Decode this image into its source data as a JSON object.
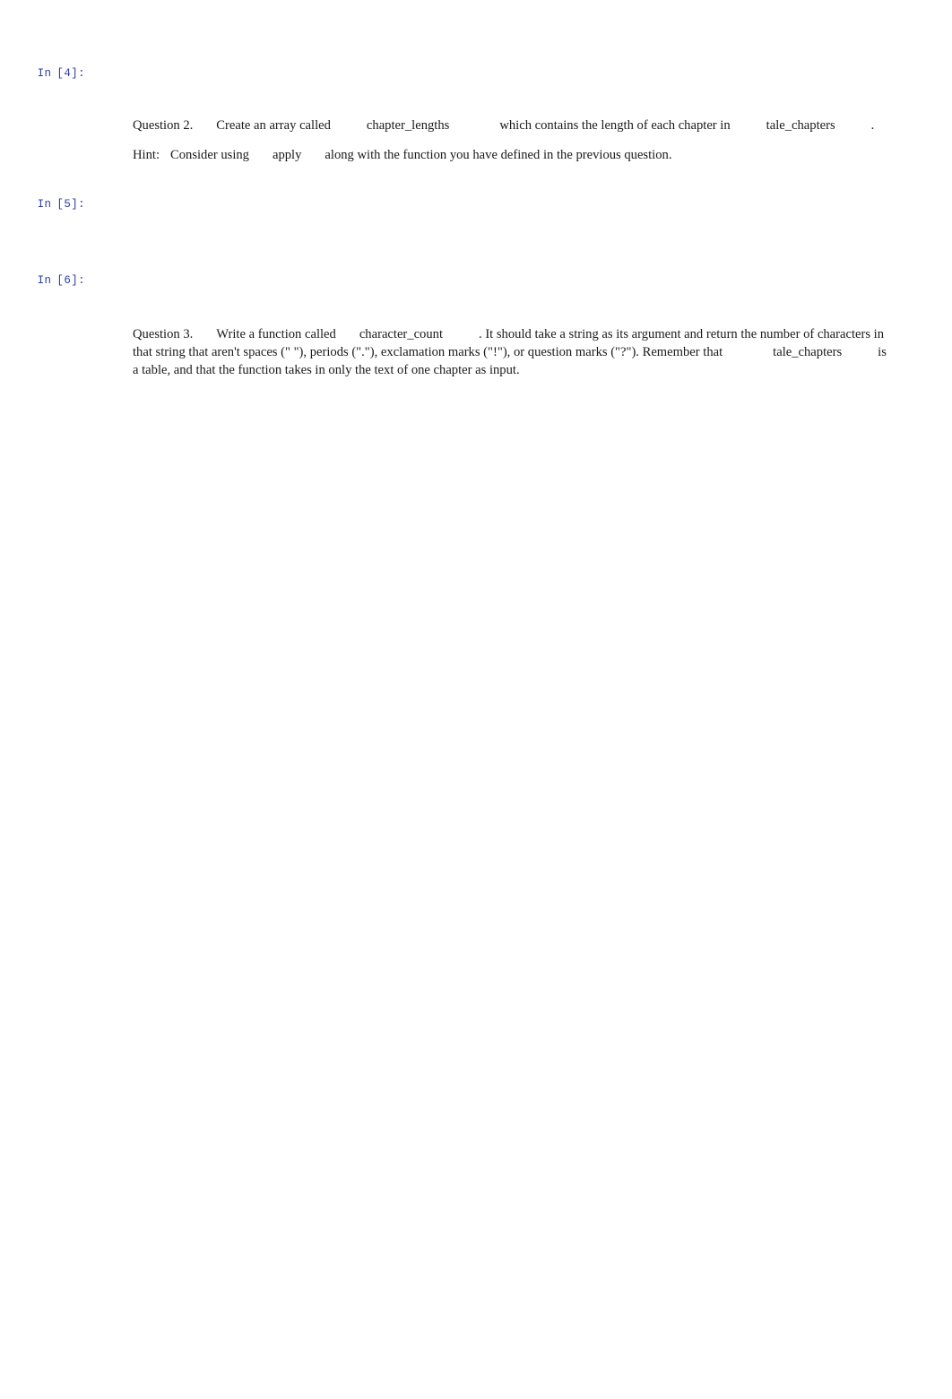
{
  "document": {
    "type": "jupyter-notebook-export",
    "background_color": "#ffffff",
    "text_color": "#1a1a1a",
    "prompt_color": "#303f9f"
  },
  "cells": [
    {
      "kind": "code",
      "prompt_in": "In",
      "prompt_num": "[4]:",
      "source": ""
    },
    {
      "kind": "markdown",
      "paragraphs": [
        {
          "label": "Question 2.",
          "segments": [
            {
              "type": "text",
              "value": "Create an array called"
            },
            {
              "type": "code",
              "value": "chapter_lengths"
            },
            {
              "type": "text",
              "value": "which contains the length of each chapter in"
            },
            {
              "type": "code",
              "value": "tale_chapters"
            },
            {
              "type": "text",
              "value": "."
            }
          ]
        },
        {
          "label": "Hint:",
          "segments": [
            {
              "type": "text",
              "value": "Consider using"
            },
            {
              "type": "code",
              "value": "apply"
            },
            {
              "type": "text",
              "value": "along with the function you have defined in the previous question."
            }
          ]
        }
      ]
    },
    {
      "kind": "code",
      "prompt_in": "In",
      "prompt_num": "[5]:",
      "source": ""
    },
    {
      "kind": "code",
      "prompt_in": "In",
      "prompt_num": "[6]:",
      "source": ""
    },
    {
      "kind": "markdown",
      "paragraphs": [
        {
          "label": "Question 3.",
          "segments": [
            {
              "type": "text",
              "value": "Write a function called"
            },
            {
              "type": "code",
              "value": "character_count"
            },
            {
              "type": "text",
              "value": ". It should take a string as its argument and return the number of characters in that string that aren't spaces (\" \"), periods (\".\"), exclamation marks (\"!\"), or question marks (\"?\"). Remember that"
            },
            {
              "type": "code",
              "value": "tale_chapters"
            },
            {
              "type": "text",
              "value": "is a table, and that the function takes in only the text of one chapter as input."
            }
          ]
        }
      ]
    }
  ],
  "text": {
    "prompt4_in": "In",
    "prompt4_num": "[4]:",
    "prompt5_in": "In",
    "prompt5_num": "[5]:",
    "prompt6_in": "In",
    "prompt6_num": "[6]:",
    "q2_label": "Question 2.",
    "q2_part1": "Create an array called",
    "q2_code1": "chapter_lengths",
    "q2_part2": "which contains the length of each chapter in",
    "q2_code2": "tale_chapters",
    "q2_part3": ".",
    "hint_label": "Hint:",
    "hint_part1": "Consider using",
    "hint_code1": "apply",
    "hint_part2": "along with the function you have defined in the previous question.",
    "q3_label": "Question 3.",
    "q3_part1": "Write a function called",
    "q3_code1": "character_count",
    "q3_part2": ". It should take a string as its argument and return the number of characters in that string that aren't spaces (\" \"), periods (\".\"), exclamation marks (\"!\"), or question marks (\"?\"). Remember that",
    "q3_code2": "tale_chapters",
    "q3_part3": "is a table, and that the function takes in only the text of one chapter as input."
  }
}
